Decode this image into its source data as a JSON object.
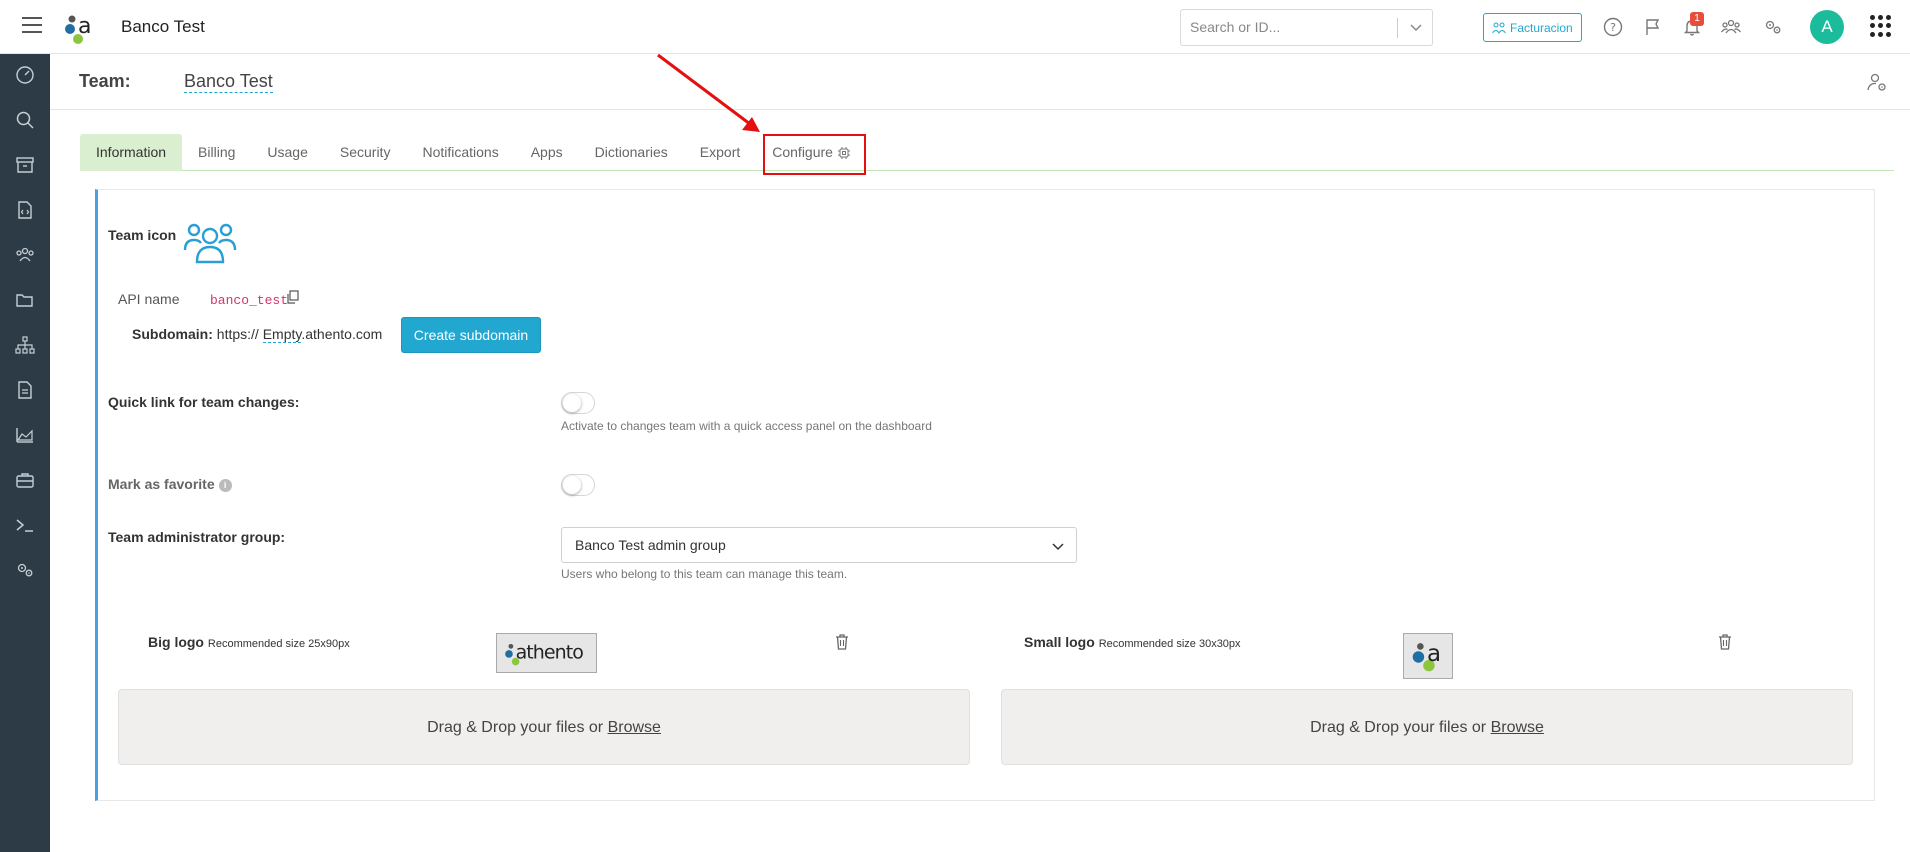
{
  "header": {
    "app_title": "Banco Test",
    "search_placeholder": "Search or ID...",
    "facturacion_label": "Facturacion",
    "notification_count": "1",
    "avatar_initial": "A"
  },
  "team": {
    "label": "Team:",
    "name": "Banco Test"
  },
  "tabs": [
    {
      "label": "Information",
      "active": true
    },
    {
      "label": "Billing"
    },
    {
      "label": "Usage"
    },
    {
      "label": "Security"
    },
    {
      "label": "Notifications"
    },
    {
      "label": "Apps"
    },
    {
      "label": "Dictionaries"
    },
    {
      "label": "Export"
    },
    {
      "label": "Configure"
    }
  ],
  "info": {
    "team_icon_label": "Team icon",
    "api_name_label": "API name",
    "api_name_value": "banco_test",
    "subdomain_label": "Subdomain:",
    "subdomain_prefix": "https://",
    "subdomain_value": "Empty",
    "subdomain_suffix": ".athento.com",
    "create_subdomain_label": "Create subdomain",
    "quick_link_label": "Quick link for team changes:",
    "quick_link_hint": "Activate to changes team with a quick access panel on the dashboard",
    "favorite_label": "Mark as favorite",
    "admin_group_label": "Team administrator group:",
    "admin_group_value": "Banco Test admin group",
    "admin_group_hint": "Users who belong to this team can manage this team.",
    "big_logo_label": "Big logo",
    "big_logo_hint": "Recommended size 25x90px",
    "big_logo_text": "athento",
    "small_logo_label": "Small logo",
    "small_logo_hint": "Recommended size 30x30px",
    "dropzone_text": "Drag & Drop your files or",
    "browse_label": "Browse"
  },
  "colors": {
    "accent": "#21a7d0",
    "sidebar": "#2d3b46",
    "active_tab": "#d9efcf",
    "annotation_red": "#e40f0f",
    "avatar": "#1abc9c"
  }
}
